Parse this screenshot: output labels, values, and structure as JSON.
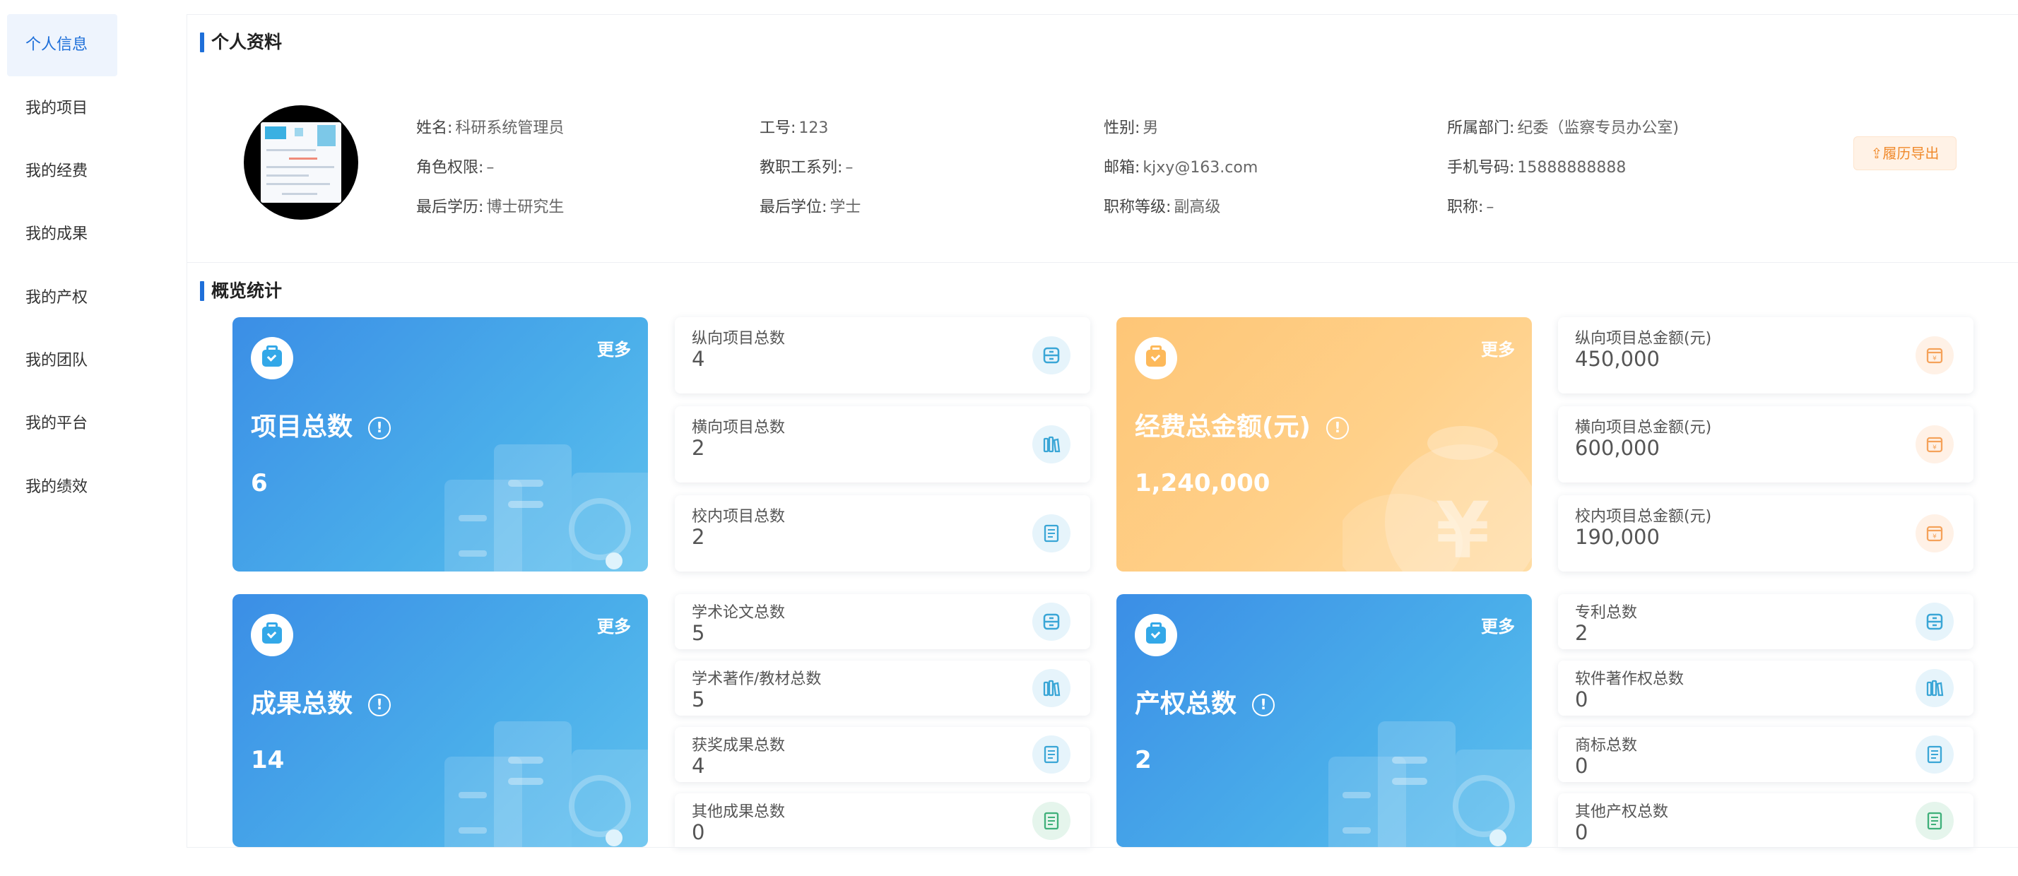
{
  "sidebar": {
    "items": [
      {
        "label": "个人信息",
        "active": true
      },
      {
        "label": "我的项目"
      },
      {
        "label": "我的经费"
      },
      {
        "label": "我的成果"
      },
      {
        "label": "我的产权"
      },
      {
        "label": "我的团队"
      },
      {
        "label": "我的平台"
      },
      {
        "label": "我的绩效"
      }
    ]
  },
  "profile": {
    "title": "个人资料",
    "export_label": "⇪履历导出",
    "fields": [
      {
        "label": "姓名:",
        "value": "科研系统管理员"
      },
      {
        "label": "工号:",
        "value": "123"
      },
      {
        "label": "性别:",
        "value": "男"
      },
      {
        "label": "所属部门:",
        "value": "纪委（监察专员办公室)"
      },
      {
        "label": "角色权限:",
        "value": "–"
      },
      {
        "label": "教职工系列:",
        "value": "–"
      },
      {
        "label": "邮箱:",
        "value": "kjxy@163.com"
      },
      {
        "label": "手机号码:",
        "value": "15888888888"
      },
      {
        "label": "最后学历:",
        "value": "博士研究生"
      },
      {
        "label": "最后学位:",
        "value": "学士"
      },
      {
        "label": "职称等级:",
        "value": "副高级"
      },
      {
        "label": "职称:",
        "value": "–"
      }
    ]
  },
  "overview": {
    "title": "概览统计",
    "more_label": "更多",
    "info_glyph": "!",
    "big_cards": [
      {
        "title": "项目总数",
        "value": "6",
        "theme": "blue",
        "icon": "clipboard-check-icon"
      },
      {
        "title": "经费总金额(元)",
        "value": "1,240,000",
        "theme": "orange",
        "icon": "wallet-icon"
      },
      {
        "title": "成果总数",
        "value": "14",
        "theme": "blue",
        "icon": "clipboard-check-icon"
      },
      {
        "title": "产权总数",
        "value": "2",
        "theme": "blue",
        "icon": "clipboard-check-icon"
      }
    ],
    "projects": [
      {
        "label": "纵向项目总数",
        "value": "4",
        "icon": "cabinet-icon",
        "tone": "blue"
      },
      {
        "label": "横向项目总数",
        "value": "2",
        "icon": "books-icon",
        "tone": "blue"
      },
      {
        "label": "校内项目总数",
        "value": "2",
        "icon": "document-icon",
        "tone": "blue"
      }
    ],
    "funds": [
      {
        "label": "纵向项目总金额(元)",
        "value": "450,000",
        "icon": "money-box-icon",
        "tone": "orange"
      },
      {
        "label": "横向项目总金额(元)",
        "value": "600,000",
        "icon": "money-box-icon",
        "tone": "orange"
      },
      {
        "label": "校内项目总金额(元)",
        "value": "190,000",
        "icon": "money-box-icon",
        "tone": "orange"
      }
    ],
    "achievements": [
      {
        "label": "学术论文总数",
        "value": "5",
        "icon": "cabinet-icon",
        "tone": "blue"
      },
      {
        "label": "学术著作/教材总数",
        "value": "5",
        "icon": "books-icon",
        "tone": "blue"
      },
      {
        "label": "获奖成果总数",
        "value": "4",
        "icon": "document-icon",
        "tone": "blue"
      },
      {
        "label": "其他成果总数",
        "value": "0",
        "icon": "document-icon",
        "tone": "green"
      }
    ],
    "property": [
      {
        "label": "专利总数",
        "value": "2",
        "icon": "cabinet-icon",
        "tone": "blue"
      },
      {
        "label": "软件著作权总数",
        "value": "0",
        "icon": "books-icon",
        "tone": "blue"
      },
      {
        "label": "商标总数",
        "value": "0",
        "icon": "document-icon",
        "tone": "blue"
      },
      {
        "label": "其他产权总数",
        "value": "0",
        "icon": "document-icon",
        "tone": "green"
      }
    ]
  },
  "colors": {
    "accent": "#1e6fd9",
    "card_blue": "#46a6ea",
    "card_orange": "#ffd089",
    "icon_blue": "#3aa6d6",
    "icon_green": "#3fb07a",
    "icon_orange": "#f5a25a"
  }
}
